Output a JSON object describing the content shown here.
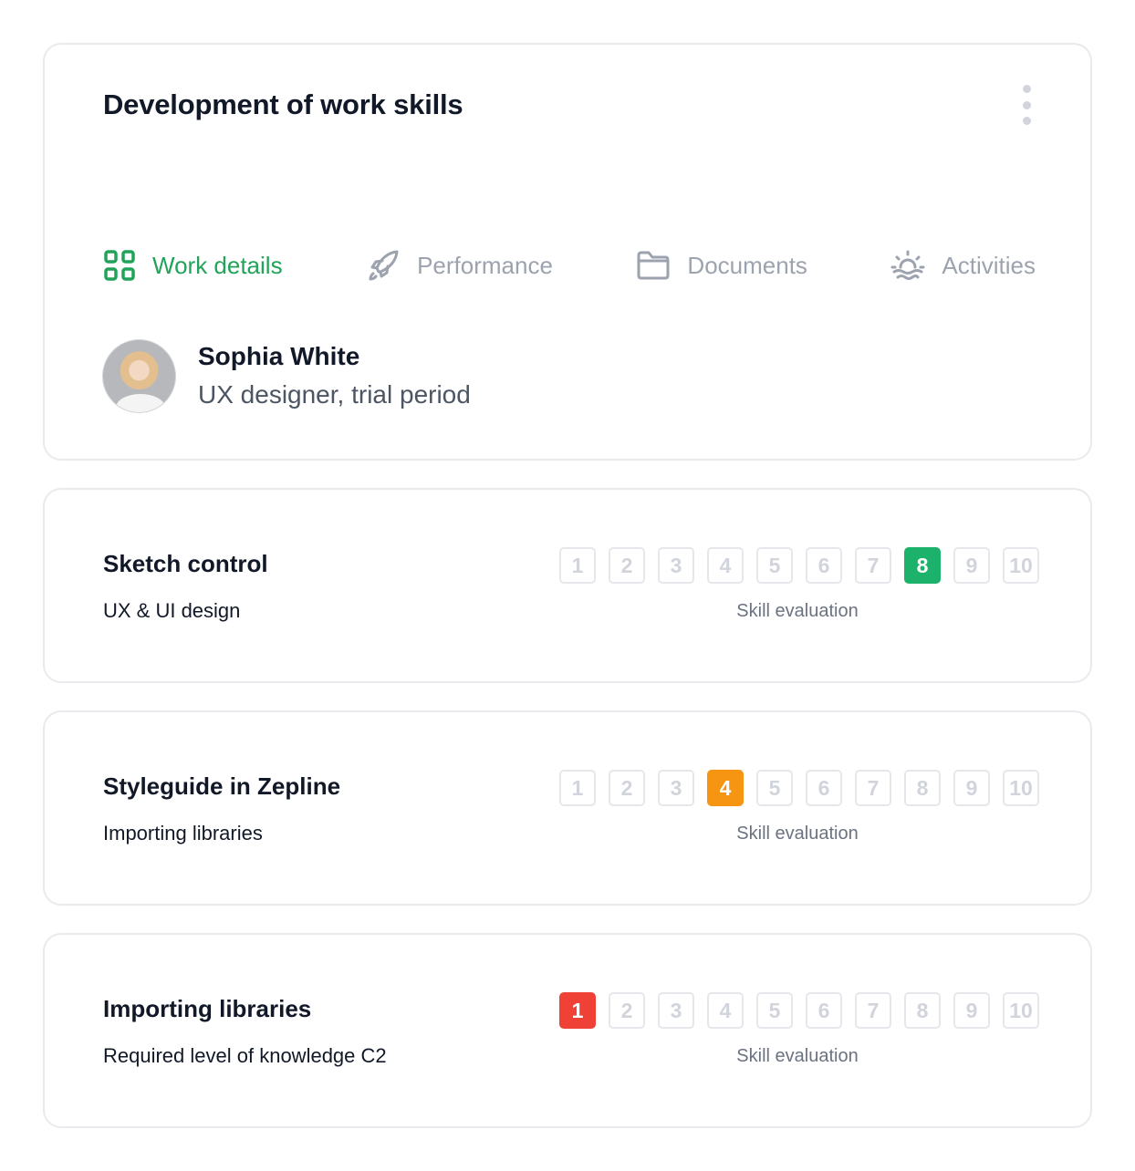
{
  "header": {
    "title": "Development of work skills",
    "more_icon": "vertical-dots-icon"
  },
  "tabs": [
    {
      "label": "Work details",
      "icon": "grid-icon",
      "active": true
    },
    {
      "label": "Performance",
      "icon": "rocket-icon",
      "active": false
    },
    {
      "label": "Documents",
      "icon": "folder-icon",
      "active": false
    },
    {
      "label": "Activities",
      "icon": "sunrise-icon",
      "active": false
    }
  ],
  "profile": {
    "name": "Sophia White",
    "role": "UX designer, trial period"
  },
  "colors": {
    "accent_green": "#22a35a",
    "rating_green": "#1db26b",
    "rating_orange": "#f59511",
    "rating_red": "#ef4136",
    "muted": "#9ca3af"
  },
  "skills": [
    {
      "title": "Sketch control",
      "subtitle": "UX & UI design",
      "rating_label": "Skill evaluation",
      "scale": [
        "1",
        "2",
        "3",
        "4",
        "5",
        "6",
        "7",
        "8",
        "9",
        "10"
      ],
      "selected": 8,
      "selected_color": "#1db26b"
    },
    {
      "title": "Styleguide in Zepline",
      "subtitle": "Importing libraries",
      "rating_label": "Skill evaluation",
      "scale": [
        "1",
        "2",
        "3",
        "4",
        "5",
        "6",
        "7",
        "8",
        "9",
        "10"
      ],
      "selected": 4,
      "selected_color": "#f59511"
    },
    {
      "title": "Importing libraries",
      "subtitle": "Required level of knowledge C2",
      "rating_label": "Skill evaluation",
      "scale": [
        "1",
        "2",
        "3",
        "4",
        "5",
        "6",
        "7",
        "8",
        "9",
        "10"
      ],
      "selected": 1,
      "selected_color": "#ef4136"
    }
  ]
}
